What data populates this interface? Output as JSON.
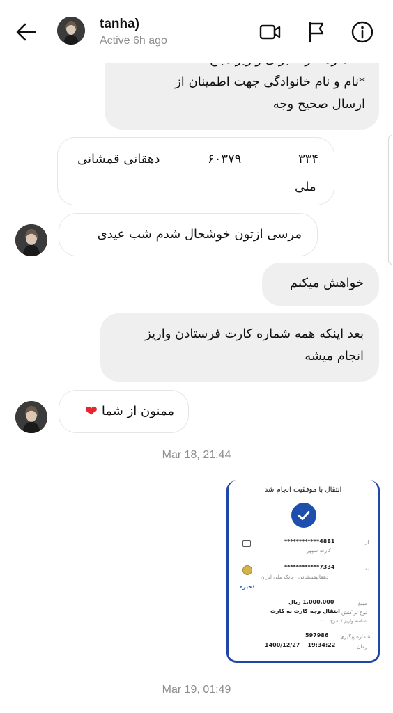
{
  "header": {
    "name": "tanha)",
    "status": "Active 6h ago"
  },
  "messages": {
    "b1": {
      "lines": [
        "*شماره کارت برای واریز مبلغ",
        "*نام و نام خانوادگی جهت اطمینان از",
        "ارسال صحیح وجه"
      ]
    },
    "b2": {
      "num_a": "۶۰۳۷۹",
      "num_b": "۳۳۴",
      "name": "دهقانی قمشانی",
      "line2": "ملی"
    },
    "b3": {
      "text": "مرسی ازتون خوشحال شدم شب عیدی"
    },
    "b4": {
      "text": "خواهش میکنم"
    },
    "b5": {
      "lines": [
        "بعد اینکه همه شماره کارت فرستادن واریز",
        "انجام میشه"
      ]
    },
    "b6": {
      "text": "ممنون از شما",
      "emoji": "❤"
    }
  },
  "timestamps": {
    "first": "Mar 18, 21:44",
    "second": "Mar 19, 01:49"
  },
  "receipt": {
    "title": "انتقال با موفقیت انجام شد",
    "from_label": "از",
    "from_card": "************4881",
    "from_bank": "کارت سپهر",
    "to_label": "به",
    "to_card": "************7334",
    "to_name": "دهقانیقمشانی - بانک ملی ایران",
    "save": "ذخیره",
    "amount_label": "مبلغ",
    "amount": "1,000,000 ریال",
    "type_label": "نوع تراکنش",
    "type": "انتقال وجه کارت به کارت",
    "desc_label": "شناسه واریز / شرح",
    "desc": "-",
    "tracking_label": "شماره پیگیری",
    "tracking": "597986",
    "time_label": "زمان",
    "time": "1400/12/27    19:34:22"
  },
  "colors": {
    "bubble_gray": "#efefef",
    "heart": "#e8262e",
    "receipt_blue": "#1f4fae",
    "muted": "#8e8e8e"
  }
}
